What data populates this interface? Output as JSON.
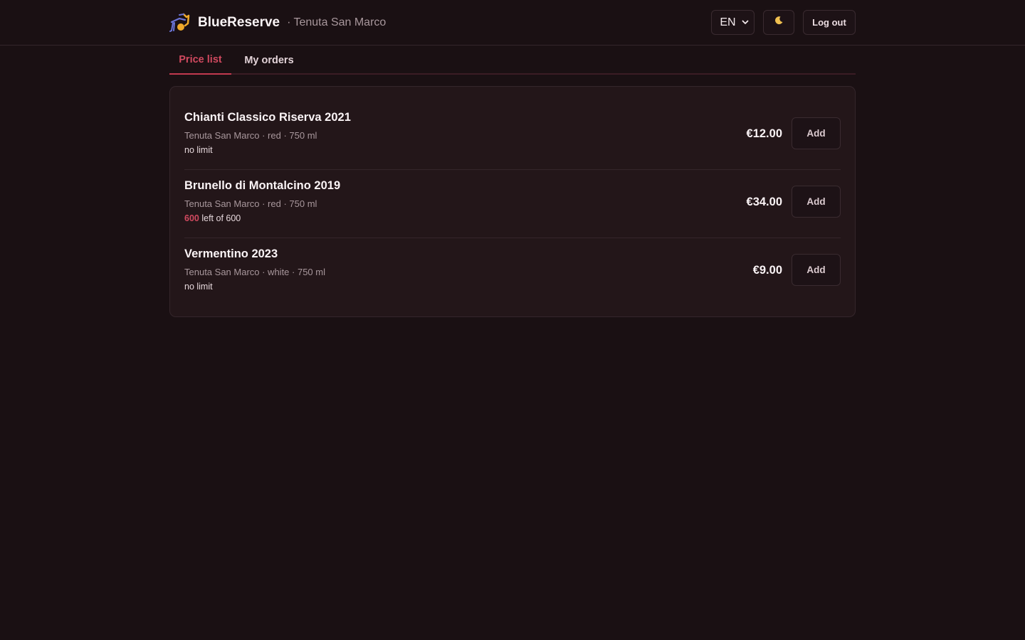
{
  "header": {
    "app_name": "BlueReserve",
    "separator": "·",
    "winery": "Tenuta San Marco",
    "language": "EN",
    "logout_label": "Log out"
  },
  "tabs": [
    {
      "label": "Price list",
      "active": true
    },
    {
      "label": "My orders",
      "active": false
    }
  ],
  "products": [
    {
      "name": "Chianti Classico Riserva 2021",
      "meta": "Tenuta San Marco · red · 750 ml",
      "limit_text": "no limit",
      "remaining": null,
      "total": null,
      "price": "€12.00",
      "add_label": "Add"
    },
    {
      "name": "Brunello di Montalcino 2019",
      "meta": "Tenuta San Marco · red · 750 ml",
      "limit_text": "left of 600",
      "remaining": "600",
      "total": "600",
      "price": "€34.00",
      "add_label": "Add"
    },
    {
      "name": "Vermentino 2023",
      "meta": "Tenuta San Marco · white · 750 ml",
      "limit_text": "no limit",
      "remaining": null,
      "total": null,
      "price": "€9.00",
      "add_label": "Add"
    }
  ],
  "colors": {
    "background": "#1a1013",
    "card": "#231619",
    "accent": "#d0495f",
    "logo_blue": "#6b74d6",
    "logo_gold": "#f0a92a"
  },
  "icons": {
    "logo": "wine-carrier-logo",
    "language_dropdown": "chevron-down-icon",
    "theme_toggle": "moon-icon"
  }
}
